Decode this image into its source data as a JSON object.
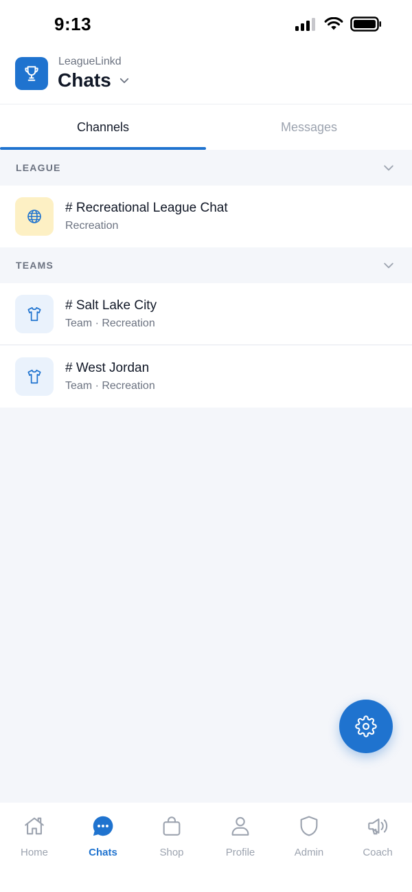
{
  "status_bar": {
    "time": "9:13"
  },
  "header": {
    "app_name": "LeagueLinkd",
    "title": "Chats"
  },
  "tabs": [
    {
      "label": "Channels",
      "active": true
    },
    {
      "label": "Messages",
      "active": false
    }
  ],
  "sections": {
    "league": {
      "label": "LEAGUE",
      "channels": [
        {
          "name": "# Recreational League Chat",
          "subtitle": "Recreation",
          "icon": "globe-icon"
        }
      ]
    },
    "teams": {
      "label": "TEAMS",
      "channels": [
        {
          "name": "# Salt Lake City",
          "subtitle": "Team · Recreation",
          "icon": "shirt-icon"
        },
        {
          "name": "# West Jordan",
          "subtitle": "Team · Recreation",
          "icon": "shirt-icon"
        }
      ]
    }
  },
  "fab": {
    "icon": "gear-icon"
  },
  "bottom_nav": [
    {
      "label": "Home",
      "icon": "home-icon",
      "active": false
    },
    {
      "label": "Chats",
      "icon": "chat-bubble-icon",
      "active": true
    },
    {
      "label": "Shop",
      "icon": "shopping-bag-icon",
      "active": false
    },
    {
      "label": "Profile",
      "icon": "person-icon",
      "active": false
    },
    {
      "label": "Admin",
      "icon": "shield-icon",
      "active": false
    },
    {
      "label": "Coach",
      "icon": "megaphone-icon",
      "active": false
    }
  ],
  "colors": {
    "accent": "#1f73cf",
    "background": "#f4f6fa",
    "league_icon_bg": "#fdf0c4",
    "team_icon_bg": "#eaf2fc"
  }
}
